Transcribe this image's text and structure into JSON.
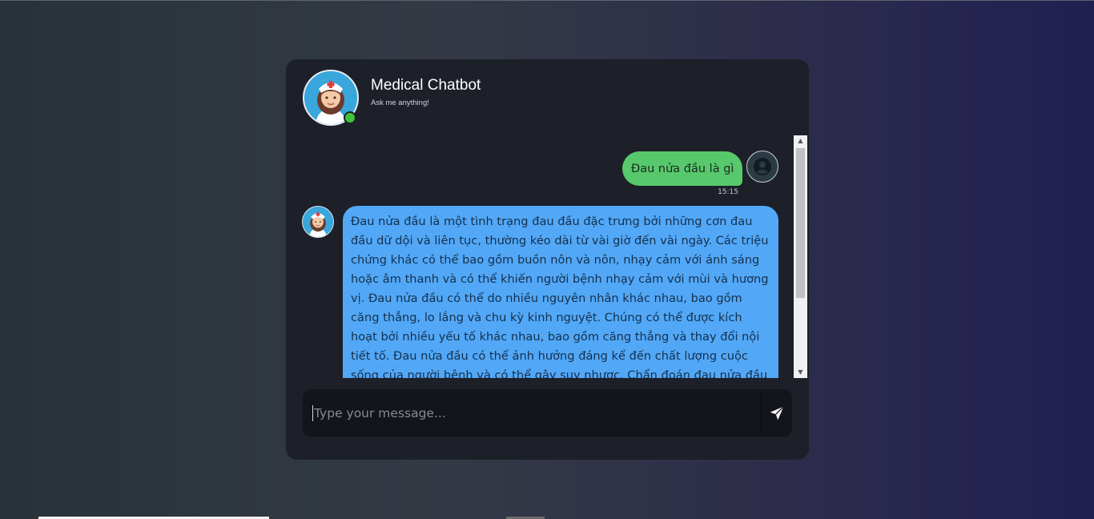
{
  "header": {
    "title": "Medical Chatbot",
    "subtitle": "Ask me anything!",
    "avatar_icon": "nurse-avatar-icon",
    "status": "online",
    "status_color": "#43c23a"
  },
  "messages": [
    {
      "role": "user",
      "text": "Đau nửa đầu là gì",
      "time": "15:15",
      "bubble_color": "#57c96c"
    },
    {
      "role": "bot",
      "text": "Đau nửa đầu là một tình trạng đau đầu đặc trưng bởi những cơn đau đầu dữ dội và liên tục, thường kéo dài từ vài giờ đến vài ngày. Các triệu chứng khác có thể bao gồm buồn nôn và nôn, nhạy cảm với ánh sáng hoặc âm thanh và có thể khiến người bệnh nhạy cảm với mùi và hương vị. Đau nửa đầu có thể do nhiều nguyên nhân khác nhau, bao gồm căng thẳng, lo lắng và chu kỳ kinh nguyệt. Chúng có thể được kích hoạt bởi nhiều yếu tố khác nhau, bao gồm căng thẳng và thay đổi nội tiết tố. Đau nửa đầu có thể ảnh hưởng đáng kể đến chất lượng cuộc sống của người bệnh và có thể gây suy nhược. Chẩn đoán đau nửa đầu được xác định bằng cách",
      "bubble_color": "#52a8f7"
    }
  ],
  "composer": {
    "placeholder": "Type your message...",
    "value": "",
    "send_icon": "send-icon"
  }
}
